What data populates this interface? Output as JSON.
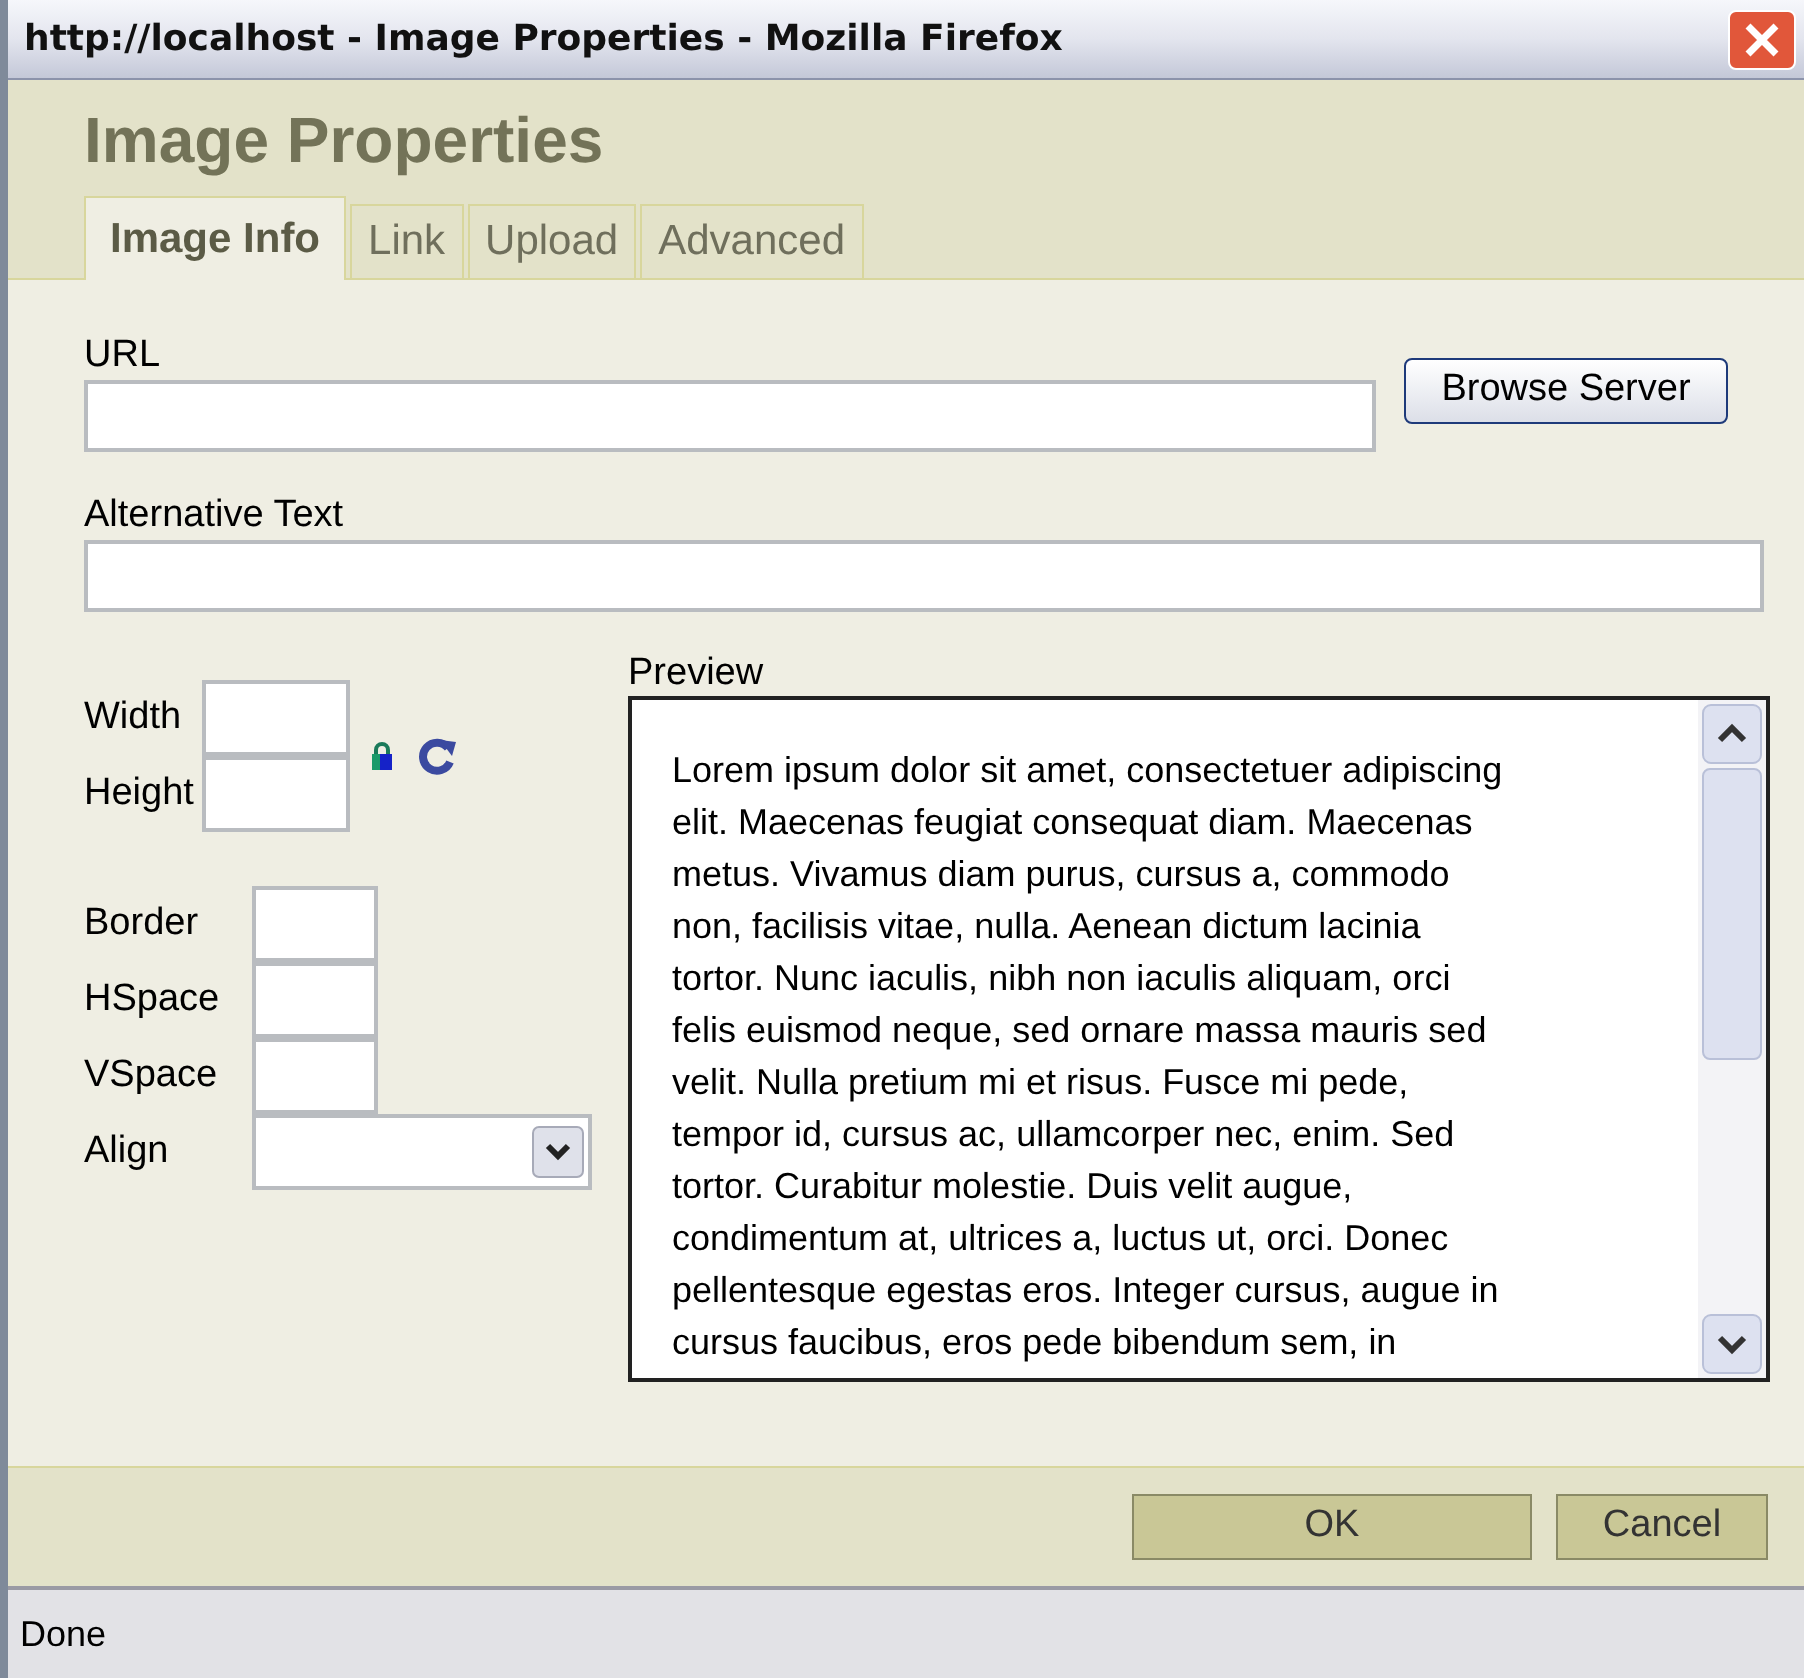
{
  "window": {
    "title": "http://localhost - Image Properties - Mozilla Firefox"
  },
  "dialog": {
    "title": "Image Properties"
  },
  "tabs": [
    {
      "label": "Image Info",
      "selected": true
    },
    {
      "label": "Link",
      "selected": false
    },
    {
      "label": "Upload",
      "selected": false
    },
    {
      "label": "Advanced",
      "selected": false
    }
  ],
  "url": {
    "label": "URL",
    "button": "Browse Server"
  },
  "alt_text": {
    "label": "Alternative Text"
  },
  "size_fields": [
    {
      "label": "Width"
    },
    {
      "label": "Height"
    }
  ],
  "layout_fields": [
    {
      "label": "Border",
      "kind": "text"
    },
    {
      "label": "HSpace",
      "kind": "text"
    },
    {
      "label": "VSpace",
      "kind": "text"
    },
    {
      "label": "Align",
      "kind": "select"
    }
  ],
  "preview": {
    "label": "Preview",
    "lines": [
      "Lorem ipsum dolor sit amet, consectetuer adipiscing",
      "elit. Maecenas feugiat consequat diam. Maecenas",
      "metus. Vivamus diam purus, cursus a, commodo",
      "non, facilisis vitae, nulla. Aenean dictum lacinia",
      "tortor. Nunc iaculis, nibh non iaculis aliquam, orci",
      "felis euismod neque, sed ornare massa mauris sed",
      "velit. Nulla pretium mi et risus. Fusce mi pede,",
      "tempor id, cursus ac, ullamcorper nec, enim. Sed",
      "tortor. Curabitur molestie. Duis velit augue,",
      "condimentum at, ultrices a, luctus ut, orci. Donec",
      "pellentesque egestas eros. Integer cursus, augue in",
      "cursus faucibus, eros pede bibendum sem, in"
    ]
  },
  "buttons": [
    "OK",
    "Cancel"
  ],
  "status_bar": {
    "text": "Done"
  }
}
